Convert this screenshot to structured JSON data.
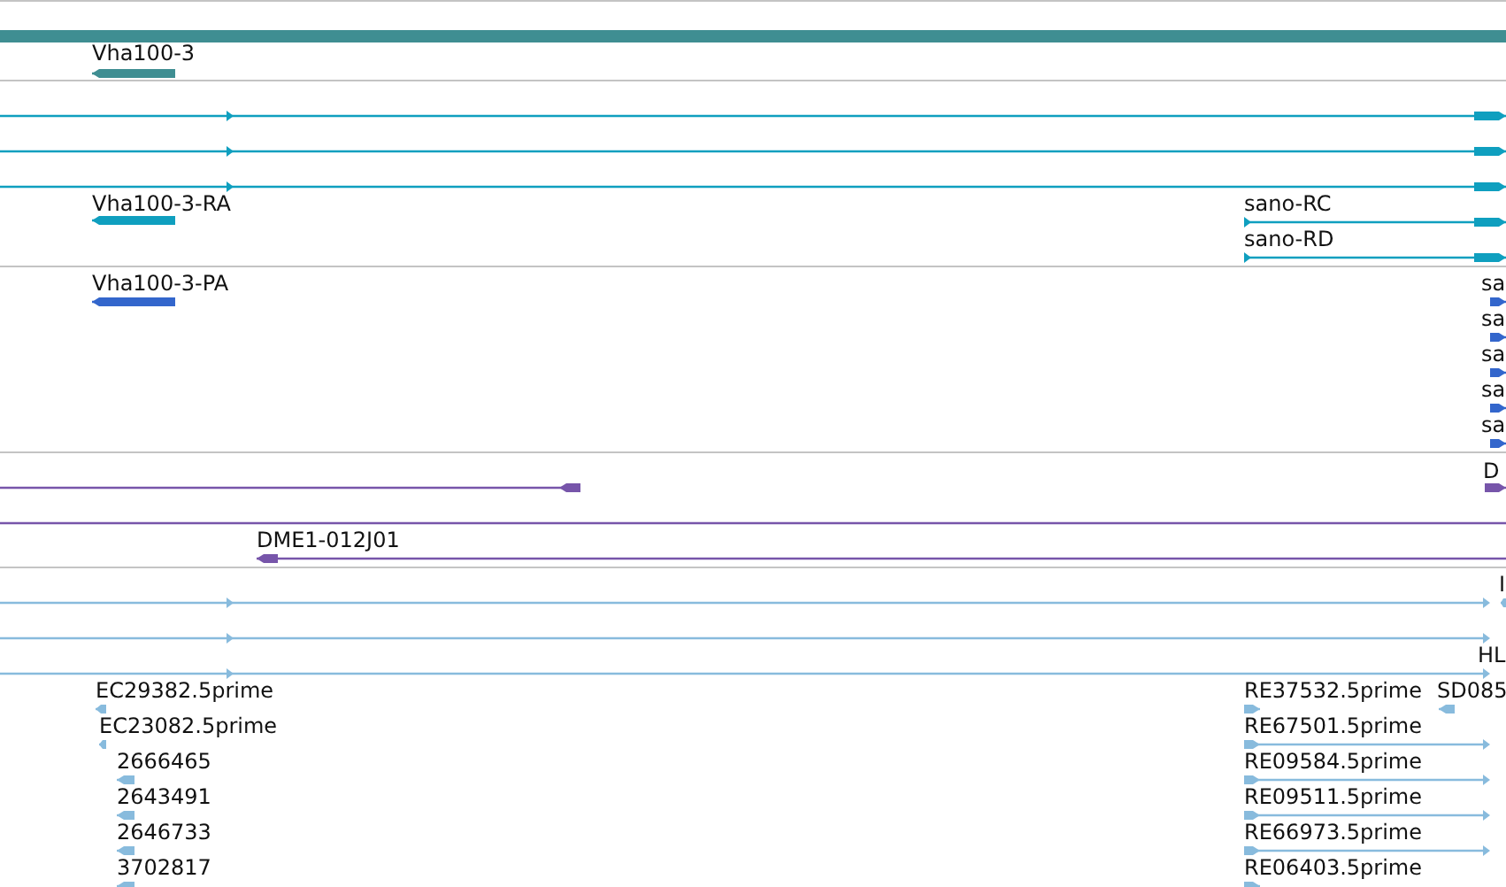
{
  "tracks": [
    {
      "kind": "gene",
      "features": [
        {
          "kind": "region"
        },
        {
          "kind": "feature",
          "label": "Vha100-3",
          "reverse": true
        }
      ]
    },
    {
      "kind": "transcript",
      "features": [
        {
          "kind": "feature",
          "reverse": false
        },
        {
          "kind": "feature",
          "reverse": false
        },
        {
          "kind": "feature",
          "reverse": false
        },
        {
          "kind": "feature",
          "label": "Vha100-3-RA",
          "reverse": true
        },
        {
          "kind": "feature",
          "label": "sano-RC",
          "reverse": false
        },
        {
          "kind": "feature",
          "label": "sano-RD",
          "reverse": false
        }
      ]
    },
    {
      "kind": "protein",
      "features": [
        {
          "kind": "feature",
          "label": "Vha100-3-PA",
          "reverse": true
        },
        {
          "kind": "feature",
          "label": "sa",
          "reverse": false
        },
        {
          "kind": "feature",
          "label": "sa",
          "reverse": false
        },
        {
          "kind": "feature",
          "label": "sa",
          "reverse": false
        },
        {
          "kind": "feature",
          "label": "sa",
          "reverse": false
        },
        {
          "kind": "feature",
          "label": "sa",
          "reverse": false
        }
      ]
    },
    {
      "kind": "clone",
      "features": [
        {
          "kind": "feature",
          "reverse": true
        },
        {
          "kind": "feature",
          "label": "D",
          "reverse": false
        },
        {
          "kind": "line"
        },
        {
          "kind": "feature",
          "label": "DME1-012J01",
          "reverse": true
        }
      ]
    },
    {
      "kind": "est",
      "features": [
        {
          "kind": "feature",
          "reverse": false
        },
        {
          "kind": "feature",
          "label": "I",
          "reverse": true
        },
        {
          "kind": "feature",
          "reverse": false
        },
        {
          "kind": "feature",
          "label": "HL",
          "reverse": false
        },
        {
          "kind": "feature",
          "label": "EC29382.5prime",
          "reverse": true
        },
        {
          "kind": "feature",
          "label": "RE37532.5prime",
          "reverse": false
        },
        {
          "kind": "feature",
          "label": "SD085",
          "reverse": true
        },
        {
          "kind": "feature",
          "label": "EC23082.5prime",
          "reverse": true
        },
        {
          "kind": "feature",
          "label": "RE67501.5prime",
          "reverse": false
        },
        {
          "kind": "feature",
          "label": "2666465",
          "reverse": true
        },
        {
          "kind": "feature",
          "label": "RE09584.5prime",
          "reverse": false
        },
        {
          "kind": "feature",
          "label": "2643491",
          "reverse": true
        },
        {
          "kind": "feature",
          "label": "RE09511.5prime",
          "reverse": false
        },
        {
          "kind": "feature",
          "label": "2646733",
          "reverse": true
        },
        {
          "kind": "feature",
          "label": "RE66973.5prime",
          "reverse": false
        },
        {
          "kind": "feature",
          "label": "3702817",
          "reverse": true
        },
        {
          "kind": "feature",
          "label": "RE06403.5prime",
          "reverse": false
        }
      ]
    }
  ]
}
